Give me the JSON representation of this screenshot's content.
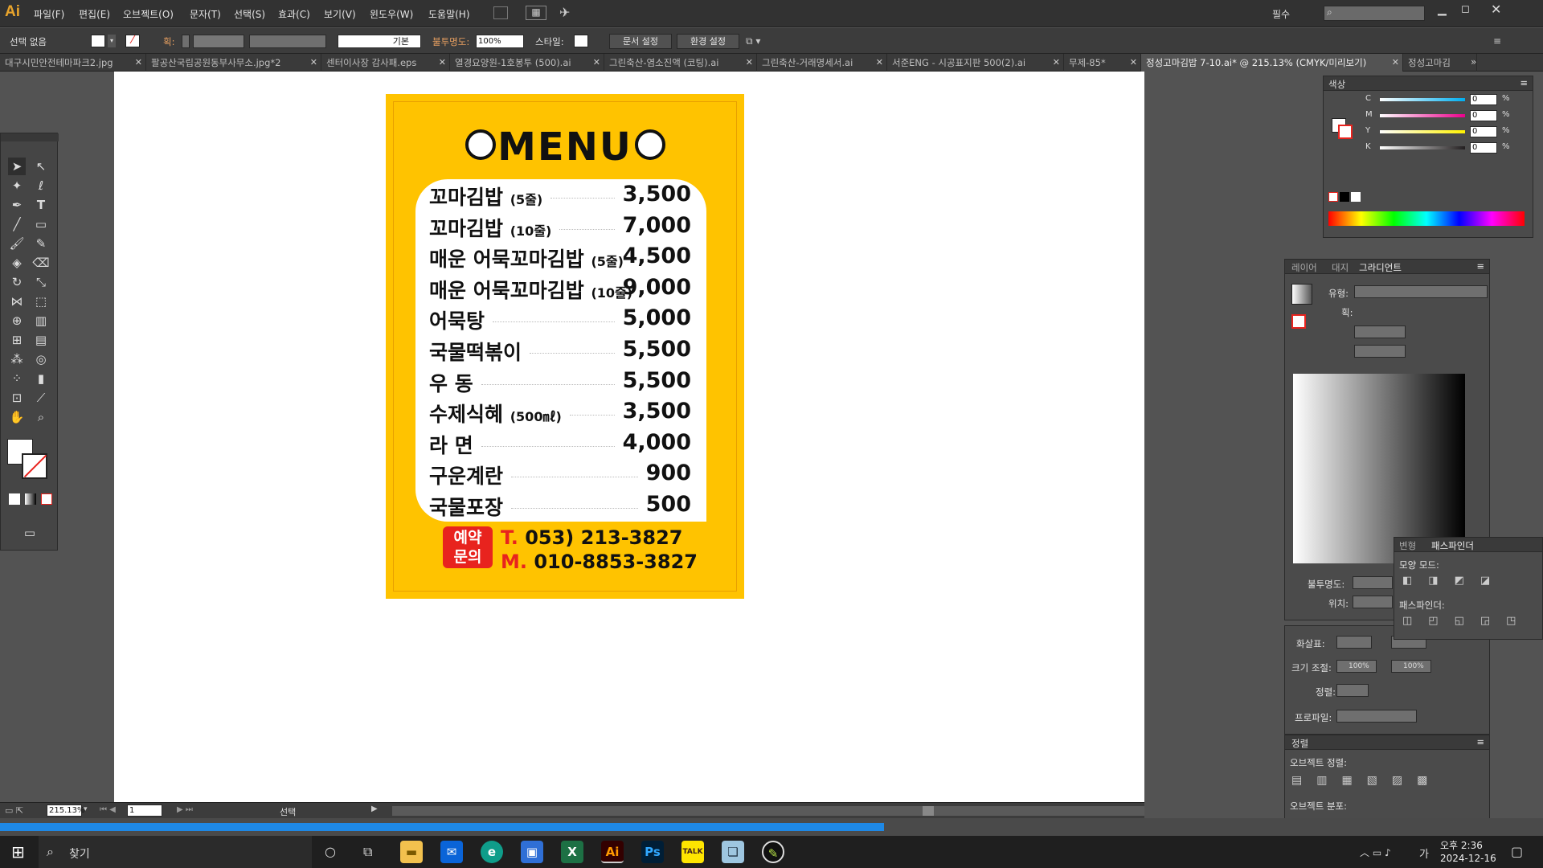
{
  "app": {
    "logo": "Ai"
  },
  "menubar": {
    "items": [
      "파일(F)",
      "편집(E)",
      "오브젝트(O)",
      "문자(T)",
      "선택(S)",
      "효과(C)",
      "보기(V)",
      "윈도우(W)",
      "도움말(H)"
    ],
    "workspace": "필수"
  },
  "control_bar": {
    "selection": "선택 없음",
    "stroke_label": "획:",
    "stroke_style": "기본",
    "opacity_label": "불투명도:",
    "opacity_value": "100%",
    "style_label": "스타일:",
    "doc_setup": "문서 설정",
    "preferences": "환경 설정"
  },
  "tabs": [
    "대구시민안전테마파크2.jpg",
    "팔공산국립공원동부사무소.jpg*2",
    "센터이사장 감사패.eps",
    "열경요양원-1호봉투 (500).ai",
    "그린축산-염소진액 (코팅).ai",
    "그린축산-거래명세서.ai",
    "서준ENG - 시공표지판 500(2).ai",
    "무제-85*",
    "정성고마김밥 7-10.ai* @ 215.13% (CMYK/미리보기)",
    "정성고마김"
  ],
  "poster": {
    "title": "MENU",
    "items": [
      {
        "name": "꼬마김밥",
        "note": "(5줄)",
        "price": "3,500"
      },
      {
        "name": "꼬마김밥",
        "note": "(10줄)",
        "price": "7,000"
      },
      {
        "name": "매운 어묵꼬마김밥",
        "note": "(5줄)",
        "price": "4,500"
      },
      {
        "name": "매운 어묵꼬마김밥",
        "note": "(10줄)",
        "price": "9,000"
      },
      {
        "name": "어묵탕",
        "note": "",
        "price": "5,000"
      },
      {
        "name": "국물떡볶이",
        "note": "",
        "price": "5,500"
      },
      {
        "name": "우 동",
        "note": "",
        "price": "5,500"
      },
      {
        "name": "수제식혜",
        "note": "(500㎖)",
        "price": "3,500"
      },
      {
        "name": "라 면",
        "note": "",
        "price": "4,000"
      },
      {
        "name": "구운계란",
        "note": "",
        "price": "900"
      },
      {
        "name": "국물포장",
        "note": "",
        "price": "500"
      }
    ],
    "reservation_line1": "예약",
    "reservation_line2": "문의",
    "tel_prefix": "T.",
    "tel": "053) 213-3827",
    "mobile_prefix": "M.",
    "mobile": "010-8853-3827"
  },
  "color_panel": {
    "title": "색상",
    "channels": [
      "C",
      "M",
      "Y",
      "K"
    ],
    "values": [
      "0",
      "0",
      "0",
      "0"
    ],
    "unit": "%"
  },
  "gradient_panel": {
    "tabs": [
      "레이어",
      "대지",
      "그라디언트"
    ],
    "type_label": "유형:",
    "stroke_label": "획:",
    "opacity_label": "불투명도:",
    "location_label": "위치:",
    "arrow_label": "화살표:",
    "scale_label": "크기 조절:",
    "scale_values": [
      "100%",
      "100%"
    ],
    "align_label": "정렬:",
    "profile_label": "프로파일:"
  },
  "pathfinder_panel": {
    "tabs": [
      "변형",
      "패스파인더"
    ],
    "shape_modes": "모양 모드:",
    "pathfinders": "패스파인더:"
  },
  "align_panel": {
    "title": "정렬",
    "align_objects": "오브젝트 정렬:",
    "distribute_objects": "오브젝트 분포:"
  },
  "statusbar": {
    "zoom": "215.13%",
    "page": "1",
    "tool": "선택"
  },
  "taskbar": {
    "search": "찾기",
    "time": "오후 2:36",
    "date": "2024-12-16",
    "ime": "가"
  },
  "colors": {
    "poster_yellow": "#ffc300",
    "accent_red": "#e8231e"
  }
}
